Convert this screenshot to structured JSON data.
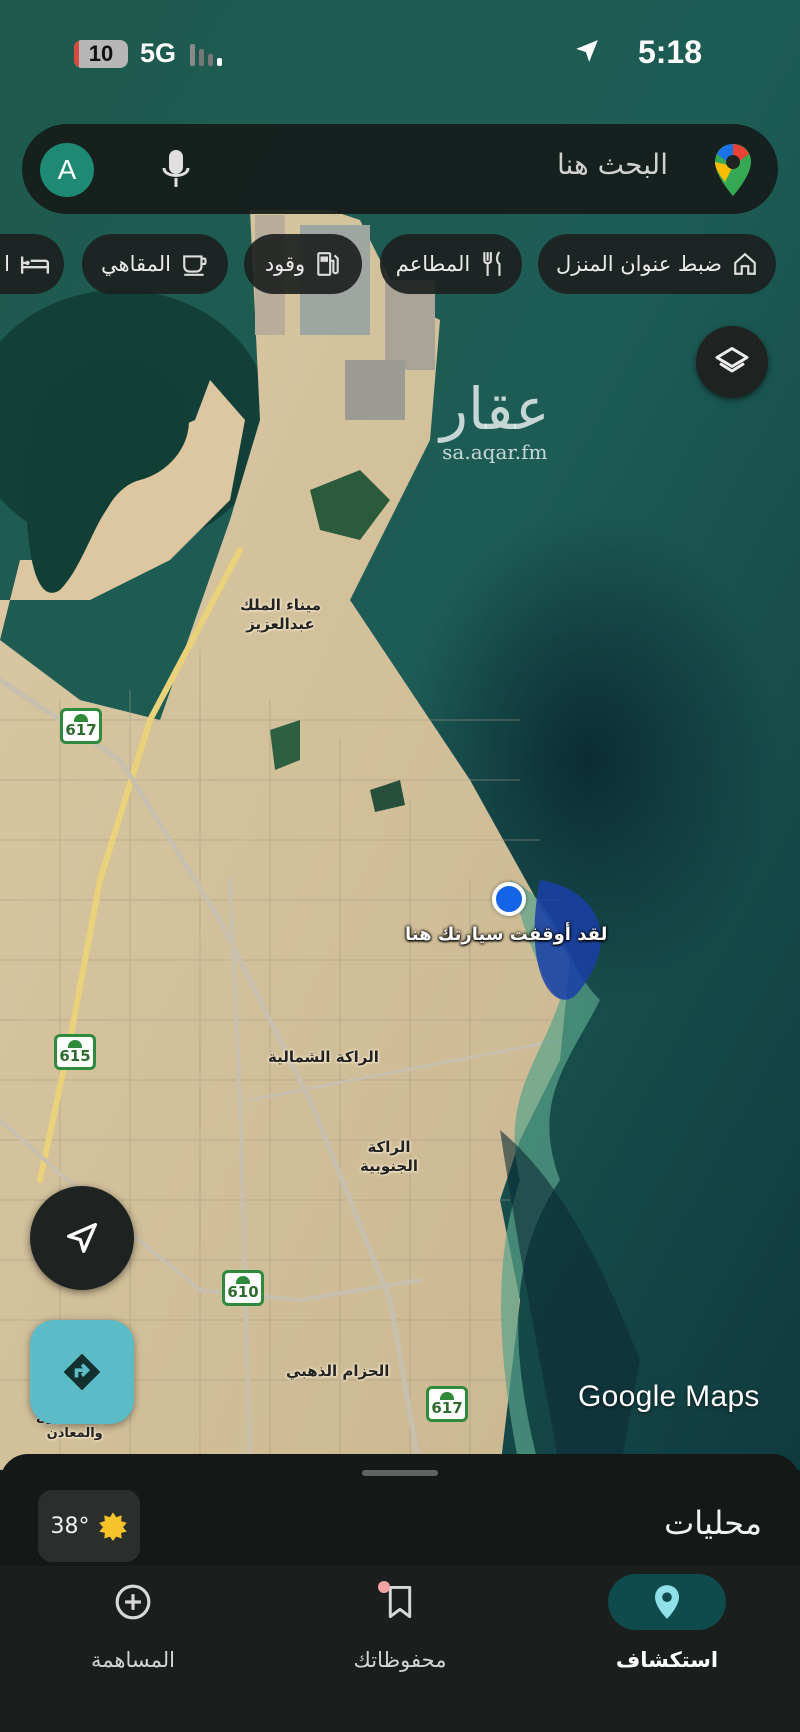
{
  "status_bar": {
    "battery_level": "10",
    "battery_fraction": 0.1,
    "network": "5G",
    "time": "5:18"
  },
  "search": {
    "placeholder": "البحث هنا",
    "avatar_letter": "A",
    "mic_icon": "microphone-icon",
    "logo_icon": "google-maps-pin-icon"
  },
  "chips": [
    {
      "label": "ضبط عنوان المنزل",
      "icon": "home-icon"
    },
    {
      "label": "المطاعم",
      "icon": "fork-knife-icon"
    },
    {
      "label": "وقود",
      "icon": "gas-pump-icon"
    },
    {
      "label": "المقاهي",
      "icon": "coffee-cup-icon"
    },
    {
      "label": "ا",
      "icon": "bed-icon"
    }
  ],
  "map": {
    "watermark": {
      "main": "عقار",
      "sub": "sa.aqar.fm"
    },
    "brand": "Google Maps",
    "parked_label": "لقد أوقفت سيارتك هنا",
    "places": {
      "port": "ميناء الملك\nعبدالعزيز",
      "rakah_north": "الراكة الشمالية",
      "rakah_south": "الراكة\nالجنوبية",
      "golden_belt": "الحزام الذهبي",
      "petroleum": "فهد للبترول\nوالمعادن"
    },
    "shields": [
      "617",
      "615",
      "610",
      "617"
    ]
  },
  "sheet": {
    "title": "محليات",
    "temperature": "38°",
    "weather_icon": "sun-icon"
  },
  "nav": {
    "explore": "استكشاف",
    "saved": "محفوظاتك",
    "contribute": "المساهمة"
  },
  "colors": {
    "accent": "#0f4a4d",
    "directions": "#5bbcc7",
    "parked": "#1565e8",
    "shield_green": "#2f8a3b"
  }
}
